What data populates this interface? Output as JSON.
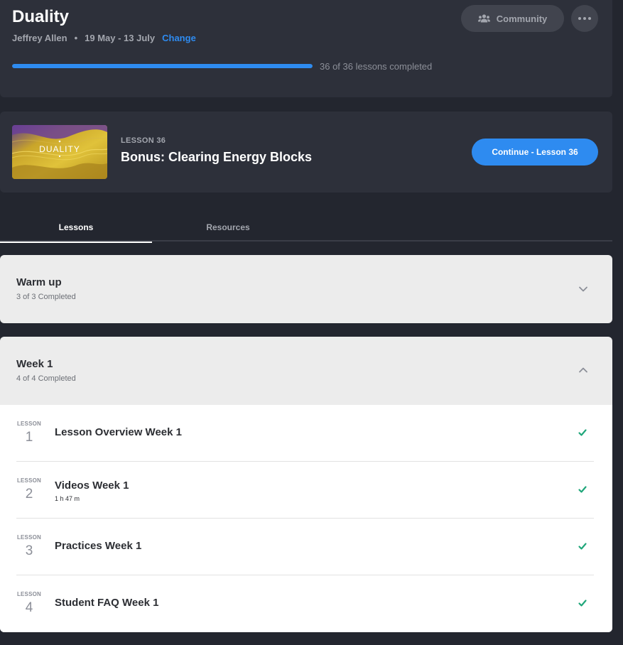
{
  "course": {
    "title": "Duality",
    "author": "Jeffrey Allen",
    "dates": "19 May - 13 July",
    "change_label": "Change",
    "community_label": "Community",
    "progress_fraction": 1.0,
    "progress_text": "36 of 36 lessons completed"
  },
  "current_lesson": {
    "thumbnail_title": "DUALITY",
    "label": "LESSON 36",
    "title": "Bonus: Clearing Energy Blocks",
    "continue_label": "Continue - Lesson 36"
  },
  "tabs": [
    {
      "label": "Lessons",
      "active": true
    },
    {
      "label": "Resources",
      "active": false
    }
  ],
  "sections": [
    {
      "title": "Warm up",
      "subtitle": "3 of 3 Completed",
      "expanded": false
    },
    {
      "title": "Week 1",
      "subtitle": "4 of 4 Completed",
      "expanded": true,
      "lessons": [
        {
          "label": "LESSON",
          "number": "1",
          "title": "Lesson Overview Week 1",
          "duration": ""
        },
        {
          "label": "LESSON",
          "number": "2",
          "title": "Videos Week 1",
          "duration": "1 h 47 m"
        },
        {
          "label": "LESSON",
          "number": "3",
          "title": "Practices Week 1",
          "duration": ""
        },
        {
          "label": "LESSON",
          "number": "4",
          "title": "Student FAQ Week 1",
          "duration": ""
        }
      ]
    }
  ],
  "colors": {
    "accent": "#2e8bf0",
    "check": "#1fa67a",
    "background": "#23262f",
    "card": "#2d303a"
  }
}
